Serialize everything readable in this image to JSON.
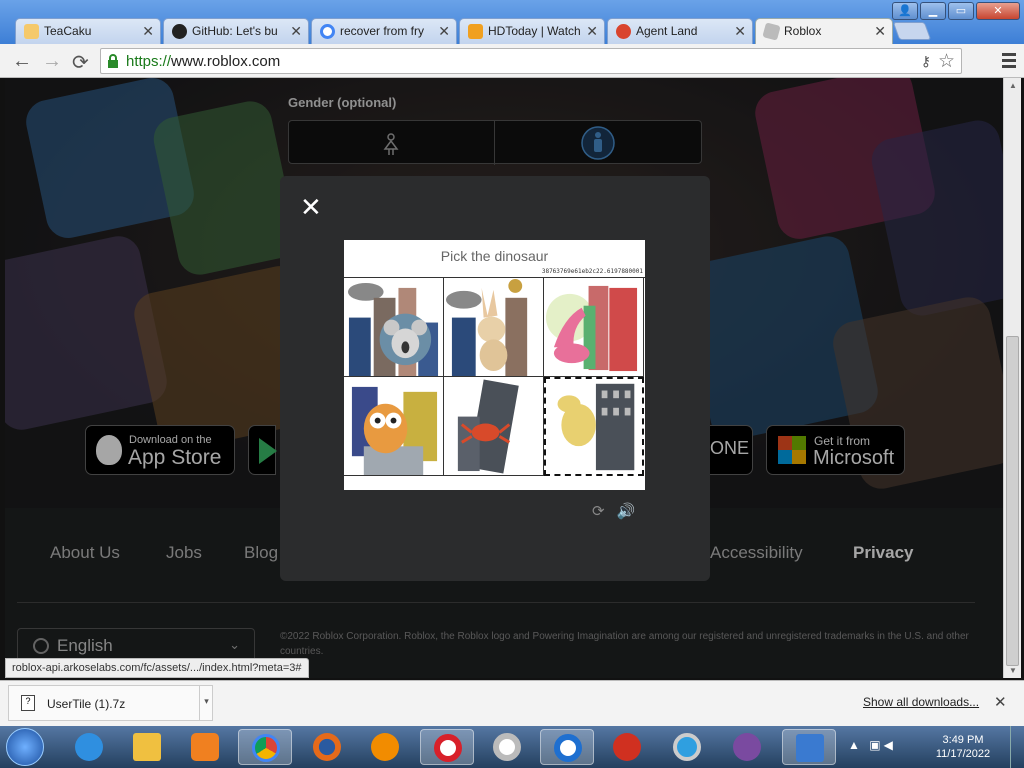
{
  "browser": {
    "tabs": [
      {
        "label": "TeaCaku",
        "favicon": "page-icon",
        "color": "#f5c96b"
      },
      {
        "label": "GitHub: Let's bu",
        "favicon": "github-icon",
        "color": "#222222"
      },
      {
        "label": "recover from fry",
        "favicon": "google-icon",
        "color": "#4285f4"
      },
      {
        "label": "HDToday | Watch",
        "favicon": "hdtoday-icon",
        "color": "#f0a020"
      },
      {
        "label": "Agent Land",
        "favicon": "agentland-icon",
        "color": "#d9442e"
      },
      {
        "label": "Roblox",
        "favicon": "roblox-icon",
        "color": "#bbbbbb"
      }
    ],
    "url_scheme": "https://",
    "url_host": "www.roblox.com",
    "status_url": "roblox-api.arkoselabs.com/fc/assets/.../index.html?meta=3#"
  },
  "page": {
    "gender_label": "Gender (optional)",
    "stores": [
      {
        "top": "Download on the",
        "bottom": "App Store"
      },
      {
        "top": "",
        "bottom": "ONE"
      },
      {
        "top": "Get it from",
        "bottom": "Microsoft"
      }
    ],
    "footer_links": [
      "About Us",
      "Jobs",
      "Blog",
      "Accessibility",
      "Privacy"
    ],
    "language": "English",
    "copyright": "©2022 Roblox Corporation. Roblox, the Roblox logo and Powering Imagination are among our registered and unregistered trademarks in the U.S. and other countries."
  },
  "captcha": {
    "close_symbol": "✕",
    "title": "Pick the dinosaur",
    "session_id": "38763769e61eb2c22.6197880001",
    "cells": [
      {
        "subject": "koala",
        "selected": false
      },
      {
        "subject": "rabbit",
        "selected": false
      },
      {
        "subject": "dinosaur",
        "selected": false
      },
      {
        "subject": "owl",
        "selected": false
      },
      {
        "subject": "crab",
        "selected": false
      },
      {
        "subject": "dog",
        "selected": true
      }
    ],
    "reload_symbol": "⟳",
    "audio_symbol": "🔊"
  },
  "downloads": {
    "file_name": "UserTile (1).7z",
    "show_all": "Show all downloads..."
  },
  "taskbar": {
    "time": "3:49 PM",
    "date": "11/17/2022",
    "apps": [
      {
        "name": "ie",
        "color": "#2f8fe0"
      },
      {
        "name": "explorer",
        "color": "#f0c040"
      },
      {
        "name": "media-player",
        "color": "#f08020"
      },
      {
        "name": "chrome",
        "color": "#4aa04a"
      },
      {
        "name": "firefox",
        "color": "#e56a1a"
      },
      {
        "name": "avast",
        "color": "#f28c00"
      },
      {
        "name": "opera",
        "color": "#d8202a"
      },
      {
        "name": "opera-gray",
        "color": "#bbbbbb"
      },
      {
        "name": "opera-blue",
        "color": "#1e6fd0"
      },
      {
        "name": "ccleaner",
        "color": "#d03020"
      },
      {
        "name": "quicktime",
        "color": "#2f9fe0"
      },
      {
        "name": "tor",
        "color": "#7a4aa0"
      },
      {
        "name": "remote",
        "color": "#3a7ad0"
      }
    ]
  }
}
